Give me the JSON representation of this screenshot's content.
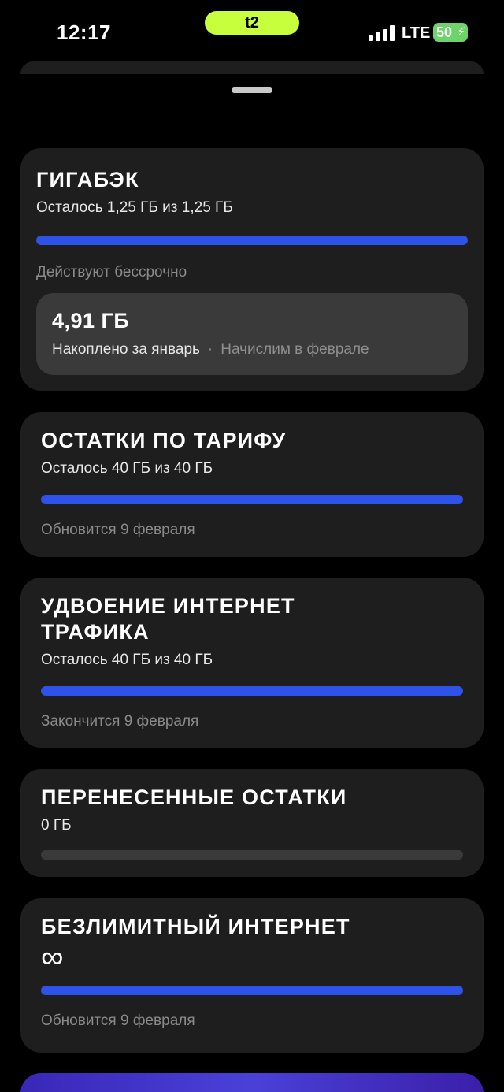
{
  "status_bar": {
    "time": "12:17",
    "carrier": "t2",
    "network": "LTE",
    "battery": "50"
  },
  "cards": [
    {
      "title": "ГИГАБЭК",
      "subtitle": "Осталось 1,25 ГБ из 1,25 ГБ",
      "progress": 1.0,
      "note": "Действуют бессрочно",
      "accumulated": {
        "value": "4,91 ГБ",
        "label": "Накоплено за январь",
        "separator": "·",
        "status": "Начислим в феврале"
      }
    },
    {
      "title": "ОСТАТКИ ПО ТАРИФУ",
      "subtitle": "Осталось 40 ГБ из 40 ГБ",
      "progress": 1.0,
      "note": "Обновится 9 февраля"
    },
    {
      "title": "УДВОЕНИЕ ИНТЕРНЕТ ТРАФИКА",
      "subtitle": "Осталось 40 ГБ из 40 ГБ",
      "progress": 1.0,
      "note": "Закончится 9 февраля"
    },
    {
      "title": "ПЕРЕНЕСЕННЫЕ ОСТАТКИ",
      "subtitle": "0 ГБ",
      "progress": 0.0
    },
    {
      "title": "БЕЗЛИМИТНЫЙ ИНТЕРНЕТ",
      "subtitle": "∞",
      "progress": 1.0,
      "note": "Обновится 9 февраля"
    }
  ],
  "colors": {
    "accent": "#2f52ea",
    "card_bg": "#1e1e1e",
    "brand_pill": "#c8ff3c"
  }
}
